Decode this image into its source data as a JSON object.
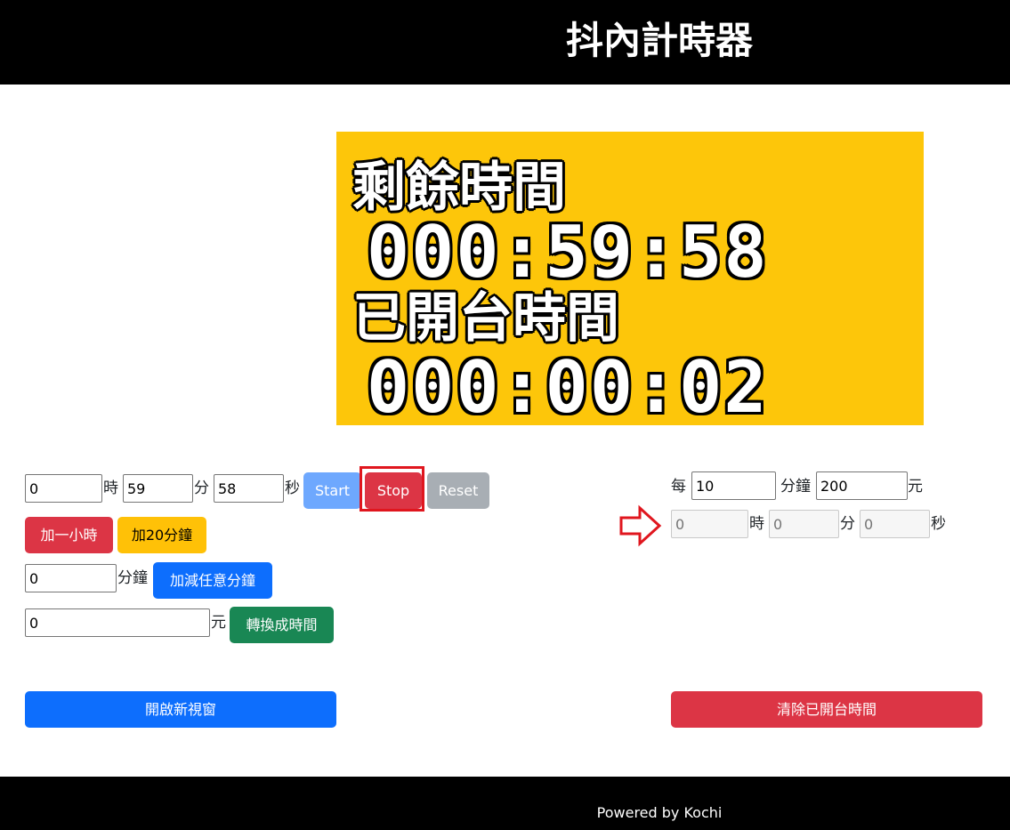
{
  "header": {
    "title": "抖內計時器"
  },
  "display": {
    "remaining_label": "剩餘時間",
    "remaining_time": "000:59:58",
    "opened_label": "已開台時間",
    "opened_time": "000:00:02",
    "background_color": "#fdc60a"
  },
  "timer": {
    "hours_value": "0",
    "hours_unit": "時",
    "minutes_value": "59",
    "minutes_unit": "分",
    "seconds_value": "58",
    "seconds_unit": "秒",
    "start_label": "Start",
    "stop_label": "Stop",
    "reset_label": "Reset"
  },
  "quick_add": {
    "add_hour_label": "加一小時",
    "add_20min_label": "加20分鐘"
  },
  "custom_minutes": {
    "value": "0",
    "unit": "分鐘",
    "button_label": "加減任意分鐘"
  },
  "convert": {
    "value": "0",
    "unit": "元",
    "button_label": "轉換成時間"
  },
  "rate": {
    "prefix": "每",
    "minutes_value": "10",
    "minutes_unit": "分鐘",
    "amount_value": "200",
    "amount_unit": "元",
    "arrow_icon": "arrow-right-outline-icon",
    "result_hours_placeholder": "0",
    "result_hours_unit": "時",
    "result_minutes_placeholder": "0",
    "result_minutes_unit": "分",
    "result_seconds_placeholder": "0",
    "result_seconds_unit": "秒"
  },
  "actions": {
    "open_window_label": "開啟新視窗",
    "clear_opened_label": "清除已開台時間"
  },
  "footer": {
    "text": "Powered by Kochi"
  },
  "colors": {
    "start": "#6ea8fe",
    "danger": "#dc3545",
    "secondary": "#a8aeb4",
    "warning": "#ffc107",
    "primary": "#0d6efd",
    "success": "#198754",
    "highlight": "#e0161e"
  }
}
